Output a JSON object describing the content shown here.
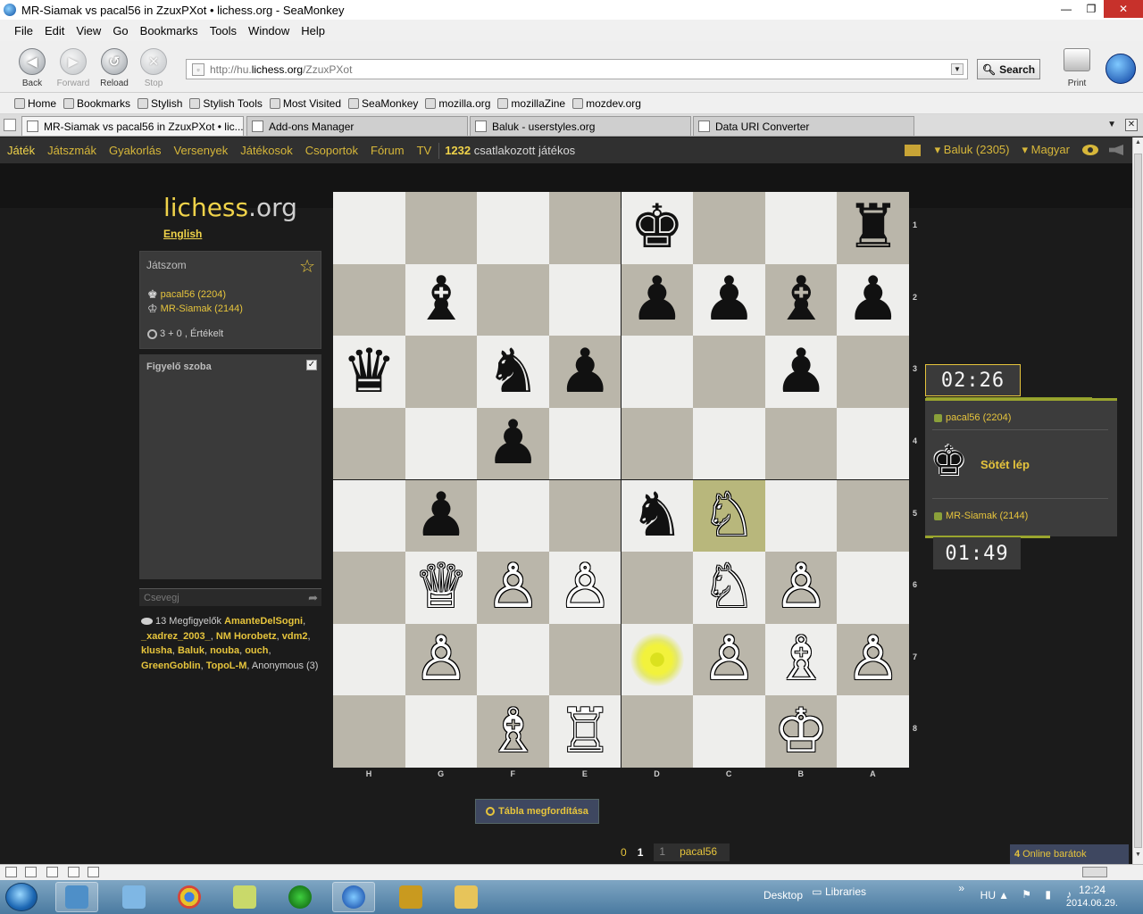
{
  "window": {
    "title": "MR-Siamak vs pacal56 in ZzuxPXot • lichess.org - SeaMonkey",
    "min": "—",
    "max": "❐",
    "close": "✕"
  },
  "menu": [
    "File",
    "Edit",
    "View",
    "Go",
    "Bookmarks",
    "Tools",
    "Window",
    "Help"
  ],
  "nav": {
    "back": "Back",
    "forward": "Forward",
    "reload": "Reload",
    "stop": "Stop",
    "url_prefix": "http://hu.",
    "url_domain": "lichess.org",
    "url_path": "/ZzuxPXot",
    "search": "Search",
    "print": "Print"
  },
  "bookmarks": [
    "Home",
    "Bookmarks",
    "Stylish",
    "Stylish Tools",
    "Most Visited",
    "SeaMonkey",
    "mozilla.org",
    "mozillaZine",
    "mozdev.org"
  ],
  "tabs": [
    {
      "label": "MR-Siamak vs pacal56 in ZzuxPXot • lic...",
      "active": true
    },
    {
      "label": "Add-ons Manager",
      "active": false
    },
    {
      "label": "Baluk - userstyles.org",
      "active": false
    },
    {
      "label": "Data URI Converter",
      "active": false
    }
  ],
  "site_nav": {
    "links": [
      "Játék",
      "Játszmák",
      "Gyakorlás",
      "Versenyek",
      "Játékosok",
      "Csoportok",
      "Fórum",
      "TV"
    ],
    "connected_count": "1232",
    "connected_label": " csatlakozott játékos",
    "user": "Baluk (2305)",
    "language": "Magyar"
  },
  "sidebar": {
    "logo_main": "lichess",
    "logo_tld": ".org",
    "lang_link": "English",
    "playing_title": "Játszom",
    "players": [
      "pacal56 (2204)",
      "MR-Siamak (2144)"
    ],
    "clock_info": "3 + 0 , Értékelt",
    "watch_room": "Figyelő szoba",
    "chat_placeholder": "Csevegj",
    "spectator_count": "13 Megfigyelők",
    "spectators": [
      "AmanteDelSogni",
      "_xadrez_2003_",
      "NM Horobetz",
      "vdm2",
      "klusha",
      "Baluk",
      "nouba",
      "ouch",
      "GreenGoblin",
      "TopoL-M"
    ],
    "anonymous": "Anonymous (3)"
  },
  "board": {
    "ranks": [
      "1",
      "2",
      "3",
      "4",
      "5",
      "6",
      "7",
      "8"
    ],
    "files": [
      "H",
      "G",
      "F",
      "E",
      "D",
      "C",
      "B",
      "A"
    ],
    "rows": [
      [
        "",
        "",
        "",
        "",
        "♚",
        "",
        "",
        "♜"
      ],
      [
        "",
        "♝",
        "",
        "",
        "♟",
        "♟",
        "♝",
        "♟"
      ],
      [
        "♛",
        "",
        "♞",
        "♟",
        "",
        "",
        "♟",
        ""
      ],
      [
        "",
        "",
        "♟",
        "",
        "",
        "",
        "",
        ""
      ],
      [
        "",
        "♟",
        "",
        "",
        "♞",
        "♘",
        "",
        ""
      ],
      [
        "",
        "♕",
        "♙",
        "♙",
        "",
        "♘",
        "♙",
        ""
      ],
      [
        "",
        "♙",
        "",
        "",
        "",
        "♙",
        "♗",
        "♙"
      ],
      [
        "",
        "",
        "♗",
        "♖",
        "",
        "",
        "♔",
        ""
      ]
    ],
    "colors": [
      [
        "",
        "",
        "",
        "",
        "b",
        "",
        "",
        "b"
      ],
      [
        "",
        "b",
        "",
        "",
        "b",
        "b",
        "b",
        "b"
      ],
      [
        "b",
        "",
        "b",
        "b",
        "",
        "",
        "b",
        ""
      ],
      [
        "",
        "",
        "b",
        "",
        "",
        "",
        "",
        ""
      ],
      [
        "",
        "b",
        "",
        "",
        "b",
        "w",
        "",
        ""
      ],
      [
        "",
        "w",
        "w",
        "w",
        "",
        "w",
        "w",
        ""
      ],
      [
        "",
        "w",
        "",
        "",
        "",
        "w",
        "w",
        "w"
      ],
      [
        "",
        "",
        "w",
        "w",
        "",
        "",
        "w",
        ""
      ]
    ],
    "last_move_to": [
      4,
      5
    ],
    "last_move_from": [
      6,
      4
    ]
  },
  "clocks": {
    "top": "02:26",
    "bottom": "01:49",
    "top_player": "pacal56 (2204)",
    "bottom_player": "MR-Siamak (2144)",
    "turn_piece": "♚",
    "turn_text": "Sötét lép"
  },
  "controls": {
    "flip": "Tábla megfordítása",
    "move_a": "0",
    "move_b": "1",
    "move_num": "1",
    "move_player": "pacal56",
    "online_count": "4",
    "online_label": "Online barátok"
  },
  "taskbar": {
    "desktop": "Desktop",
    "libraries": "Libraries",
    "lang": "HU",
    "time": "12:24",
    "date": "2014.06.29."
  }
}
